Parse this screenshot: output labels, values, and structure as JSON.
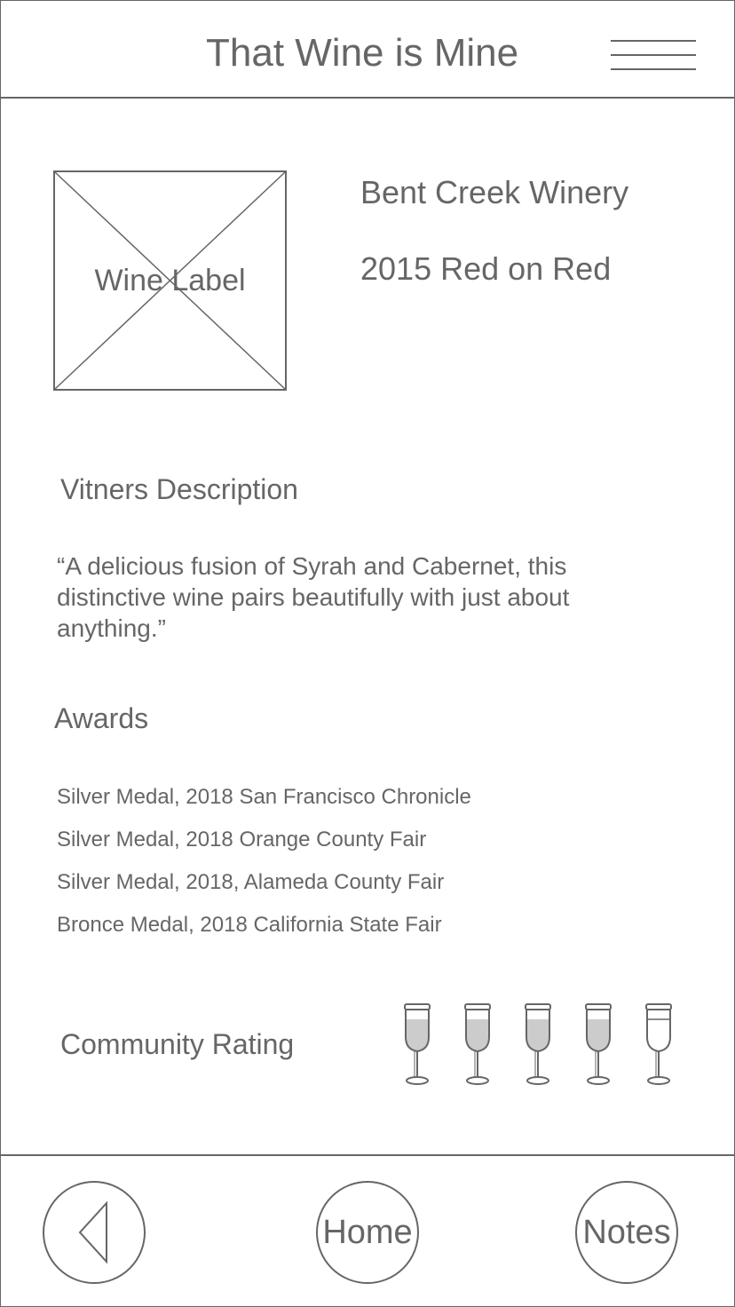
{
  "app": {
    "title": "That Wine is Mine"
  },
  "wine": {
    "label_placeholder": "Wine Label",
    "winery": "Bent Creek Winery",
    "name": "2015 Red on Red"
  },
  "description": {
    "heading": "Vitners Description",
    "text": "“A delicious fusion of Syrah and Cabernet, this distinctive wine pairs beautifully with just about anything.”"
  },
  "awards": {
    "heading": "Awards",
    "items": [
      "Silver Medal, 2018 San Francisco Chronicle",
      "Silver Medal, 2018 Orange County Fair",
      "Silver Medal, 2018, Alameda County Fair",
      "Bronce Medal, 2018 California State Fair"
    ]
  },
  "rating": {
    "label": "Community Rating",
    "icon": "wine-glass-icon",
    "max": 5,
    "value": 4
  },
  "footer": {
    "back_icon": "back-arrow-icon",
    "home_label": "Home",
    "notes_label": "Notes"
  },
  "colors": {
    "stroke": "#666666",
    "fill": "#cccccc",
    "background": "#ffffff"
  }
}
